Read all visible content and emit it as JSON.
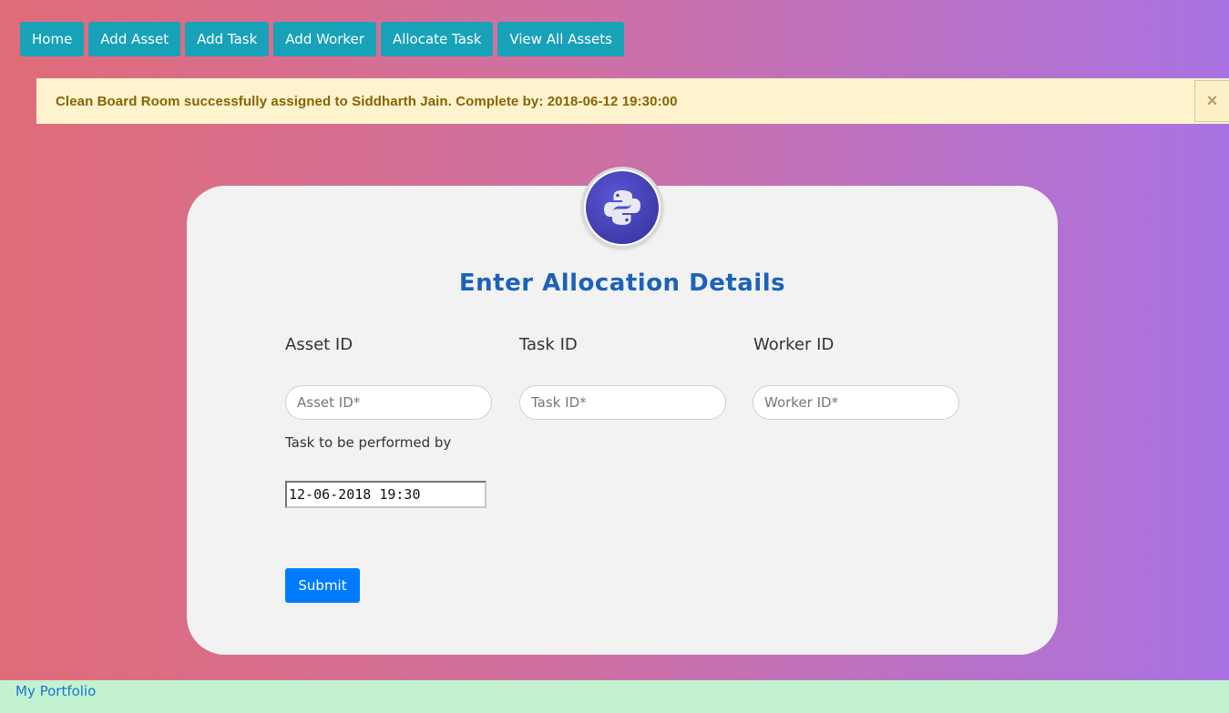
{
  "nav": {
    "items": [
      {
        "label": "Home"
      },
      {
        "label": "Add Asset"
      },
      {
        "label": "Add Task"
      },
      {
        "label": "Add Worker"
      },
      {
        "label": "Allocate Task"
      },
      {
        "label": "View All Assets"
      }
    ]
  },
  "alert": {
    "message": "Clean Board Room successfully assigned to Siddharth Jain. Complete by: 2018-06-12 19:30:00",
    "close_symbol": "×"
  },
  "form": {
    "title": "Enter Allocation Details",
    "asset": {
      "label": "Asset ID",
      "placeholder": "Asset ID*"
    },
    "task": {
      "label": "Task ID",
      "placeholder": "Task ID*"
    },
    "worker": {
      "label": "Worker ID",
      "placeholder": "Worker ID*"
    },
    "deadline": {
      "label": "Task to be performed by",
      "value": "12-06-2018 19:30"
    },
    "submit_label": "Submit",
    "logo_icon": "python-logo-icon"
  },
  "footer": {
    "link_label": "My Portfolio"
  },
  "colors": {
    "nav_button": "#17a2b8",
    "alert_bg": "#fff3cd",
    "title": "#1c62b9",
    "submit": "#007bff",
    "footer_bg": "#c3f2d0"
  }
}
